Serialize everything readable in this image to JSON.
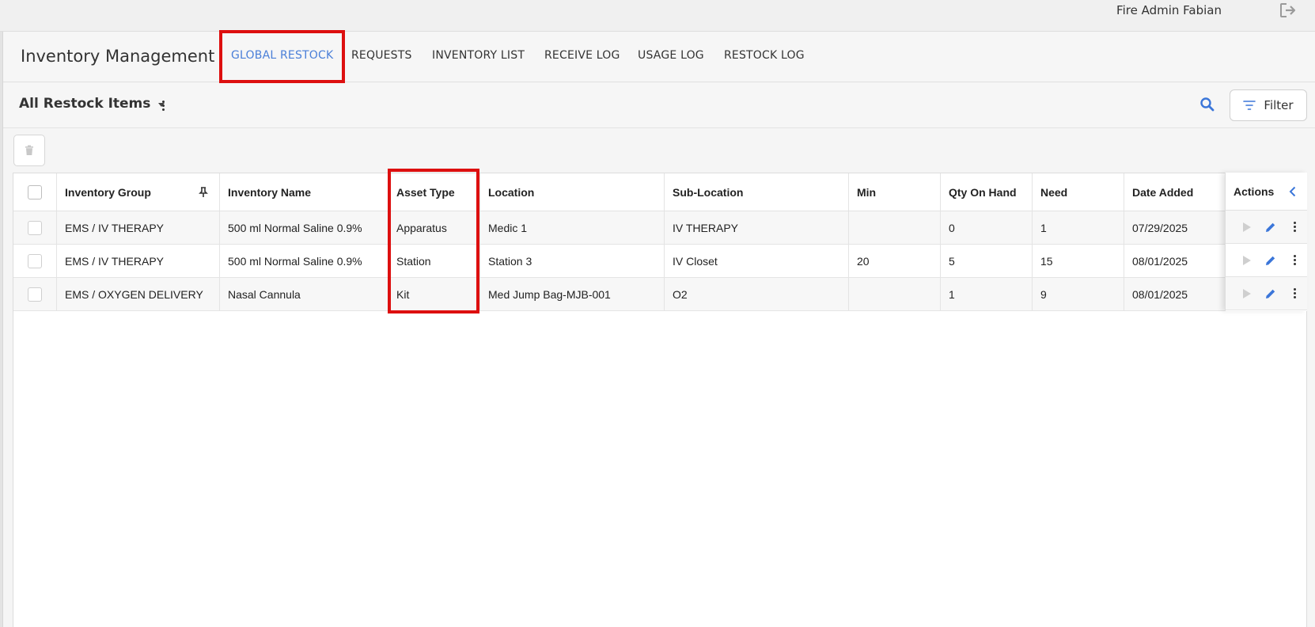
{
  "topbar": {
    "user_name": "Fire Admin Fabian",
    "logout_icon": "logout-icon"
  },
  "nav": {
    "title": "Inventory Management",
    "tabs": [
      {
        "label": "GLOBAL RESTOCK",
        "active": true
      },
      {
        "label": "REQUESTS",
        "active": false
      },
      {
        "label": "INVENTORY LIST",
        "active": false
      },
      {
        "label": "RECEIVE LOG",
        "active": false
      },
      {
        "label": "USAGE LOG",
        "active": false
      },
      {
        "label": "RESTOCK LOG",
        "active": false
      }
    ]
  },
  "toolbar": {
    "view_label": "All Restock Items",
    "search_icon": "search-icon",
    "filter_label": "Filter"
  },
  "table": {
    "columns": [
      "Inventory Group",
      "Inventory Name",
      "Asset Type",
      "Location",
      "Sub-Location",
      "Min",
      "Qty On Hand",
      "Need",
      "Date Added",
      "Actions"
    ],
    "rows": [
      {
        "group": "EMS / IV THERAPY",
        "name": "500 ml Normal Saline 0.9%",
        "asset_type": "Apparatus",
        "location": "Medic 1",
        "sub_location": "IV THERAPY",
        "min": "",
        "qty": "0",
        "need": "1",
        "date": "07/29/2025"
      },
      {
        "group": "EMS / IV THERAPY",
        "name": "500 ml Normal Saline 0.9%",
        "asset_type": "Station",
        "location": "Station 3",
        "sub_location": "IV Closet",
        "min": "20",
        "qty": "5",
        "need": "15",
        "date": "08/01/2025"
      },
      {
        "group": "EMS / OXYGEN DELIVERY",
        "name": "Nasal Cannula",
        "asset_type": "Kit",
        "location": "Med Jump Bag-MJB-001",
        "sub_location": "O2",
        "min": "",
        "qty": "1",
        "need": "9",
        "date": "08/01/2025"
      }
    ]
  },
  "colors": {
    "accent": "#4a7fd8",
    "highlight": "#dd0f0f"
  }
}
